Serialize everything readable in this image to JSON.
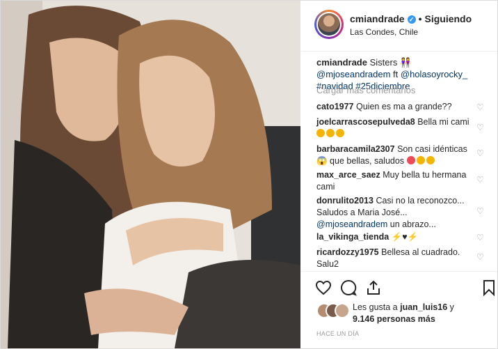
{
  "post": {
    "username": "cmiandrade",
    "verified_mark": "✓",
    "separator": "•",
    "follow_label": "Siguiendo",
    "location": "Las Condes, Chile",
    "caption_user": "cmiandrade",
    "caption_text": " Sisters 👭 ",
    "caption_mention1": "@mjoseandradem",
    "caption_ft": " ft ",
    "caption_mention2": "@holasoyrocky_",
    "caption_hashtag1": "#navidad",
    "caption_hashtag2": "#25diciembre",
    "load_more": "Cargar más comentarios",
    "comments": [
      {
        "user": "cato1977",
        "text": " Quien es ma a grande??"
      },
      {
        "user": "joelcarrascosepulveda8",
        "text": " Bella mi cami"
      },
      {
        "user": "barbaracamila2307",
        "text": " Son casi idénticas 😱 que bellas, saludos"
      },
      {
        "user": "max_arce_saez",
        "text": " Muy bella tu hermana cami"
      },
      {
        "user": "donrulito2013",
        "text": " Casi no la reconozco... Saludos a Maria José...",
        "mention": "@mjoseandradem",
        "tail": " un abrazo..."
      },
      {
        "user": "la_vikinga_tienda",
        "text": ""
      },
      {
        "user": "ricardozzy1975",
        "text": " Bellesa al cuadrado. Salu2"
      }
    ],
    "likes_prefix": "Les gusta a ",
    "likes_user": "juan_luis16",
    "likes_mid": " y",
    "likes_count": "9.146 personas más",
    "timestamp": "HACE UN DÍA",
    "colors": {
      "accent": "#3897f0",
      "link": "#003569",
      "muted": "#999999",
      "heart_red": "#ed4956"
    }
  }
}
